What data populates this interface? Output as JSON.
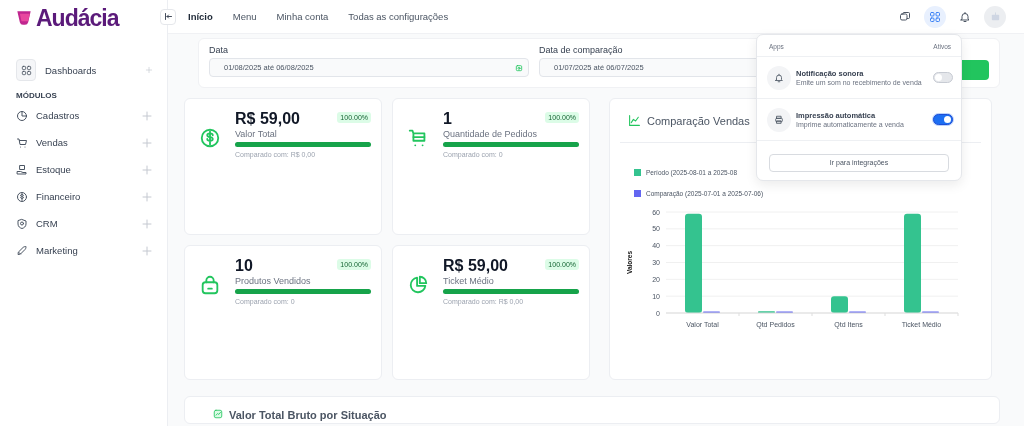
{
  "logo": {
    "text": "Audácia"
  },
  "topnav": {
    "items": [
      {
        "label": "Início",
        "selected": true
      },
      {
        "label": "Menu",
        "selected": false
      },
      {
        "label": "Minha conta",
        "selected": false
      },
      {
        "label": "Todas as configurações",
        "selected": false
      }
    ]
  },
  "sidebar": {
    "dashboard": {
      "label": "Dashboards"
    },
    "section_title": "MÓDULOS",
    "items": [
      {
        "label": "Cadastros"
      },
      {
        "label": "Vendas"
      },
      {
        "label": "Estoque"
      },
      {
        "label": "Financeiro"
      },
      {
        "label": "CRM"
      },
      {
        "label": "Marketing"
      }
    ]
  },
  "filters": [
    {
      "label": "Data",
      "value": "01/08/2025 até 06/08/2025"
    },
    {
      "label": "Data de comparação",
      "value": "01/07/2025 até 06/07/2025"
    }
  ],
  "kpis": [
    {
      "value": "R$ 59,00",
      "label": "Valor Total",
      "badge": "100.00%",
      "level": 1,
      "compare": "Comparado com: R$ 0,00"
    },
    {
      "value": "1",
      "label": "Quantidade de Pedidos",
      "badge": "100.00%",
      "level": 1,
      "compare": "Comparado com: 0"
    },
    {
      "value": "10",
      "label": "Produtos Vendidos",
      "badge": "100.00%",
      "level": 1,
      "compare": "Comparado com: 0"
    },
    {
      "value": "R$ 59,00",
      "label": "Ticket Médio",
      "badge": "100.00%",
      "level": 1,
      "compare": "Comparado com: R$ 0,00"
    }
  ],
  "chart_card": {
    "title": "Comparação Vendas",
    "chart_data": {
      "type": "bar",
      "ylabel": "Valores",
      "categories": [
        "Valor Total",
        "Qtd Pedidos",
        "Qtd Itens",
        "Ticket Médio"
      ],
      "series": [
        {
          "name": "Período (2025-08-01 a 2025-08",
          "color": "#34c38f",
          "values": [
            59,
            1,
            10,
            59
          ]
        },
        {
          "name": "Comparação (2025-07-01 a 2025-07-06)",
          "color": "#6366f1",
          "values": [
            0,
            0,
            0,
            0
          ]
        }
      ],
      "grid": true,
      "ylim": [
        0,
        60
      ],
      "yticks": [
        0,
        10,
        20,
        30,
        40,
        50,
        60
      ]
    }
  },
  "bottom_card": {
    "title": "Valor Total Bruto por Situação"
  },
  "apps_dropdown": {
    "expanded": true,
    "header": "Apps",
    "header_right": "Ativos",
    "items": [
      {
        "title": "Notificação sonora",
        "description": "Emite um som no recebimento de venda",
        "on": false
      },
      {
        "title": "Impressão automática",
        "description": "Imprime automaticamente a venda",
        "on": true
      }
    ],
    "button": "Ir para integrações"
  }
}
